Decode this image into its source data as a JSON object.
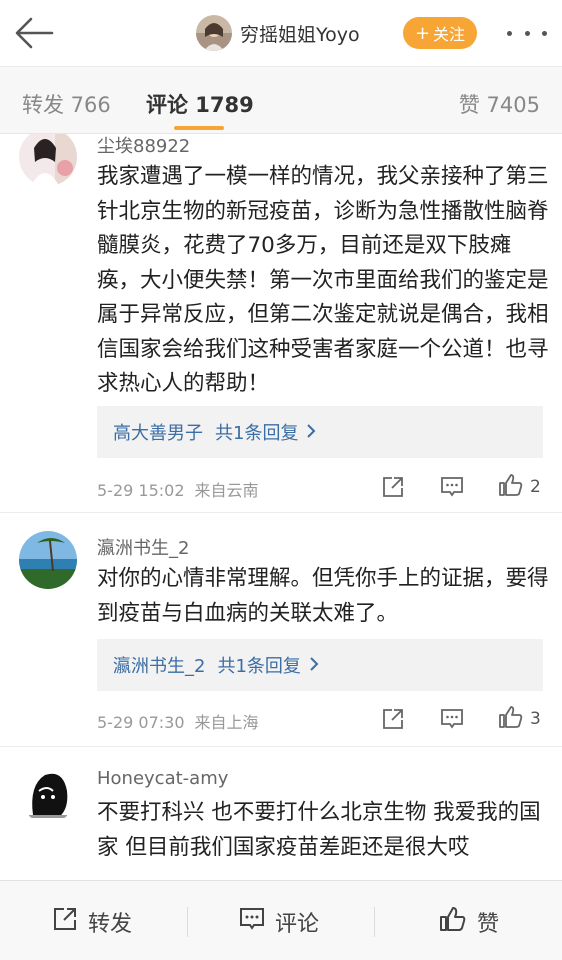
{
  "header": {
    "user_name": "穷摇姐姐Yoyo",
    "follow_label": "关注",
    "follow_plus": "+"
  },
  "tabs": {
    "repost": "转发 766",
    "comments": "评论 1789",
    "likes": "赞 7405"
  },
  "comments": [
    {
      "name": "尘埃88922",
      "text": "我家遭遇了一模一样的情况，我父亲接种了第三针北京生物的新冠疫苗，诊断为急性播散性脑脊髓膜炎，花费了70多万，目前还是双下肢瘫痪，大小便失禁！第一次市里面给我们的鉴定是属于异常反应，但第二次鉴定就说是偶合，我相信国家会给我们这种受害者家庭一个公道！也寻求热心人的帮助！",
      "reply_name": "高大善男子",
      "reply_count": "共1条回复",
      "time": "5-29 15:02",
      "location": "来自云南",
      "likes": "2"
    },
    {
      "name": "瀛洲书生_2",
      "text": "对你的心情非常理解。但凭你手上的证据，要得到疫苗与白血病的关联太难了。",
      "reply_name": "瀛洲书生_2",
      "reply_count": "共1条回复",
      "time": "5-29 07:30",
      "location": "来自上海",
      "likes": "3"
    },
    {
      "name": "Honeycat-amy",
      "text": "不要打科兴 也不要打什么北京生物 我爱我的国家 但目前我们国家疫苗差距还是很大哎"
    }
  ],
  "bottom_bar": {
    "repost": "转发",
    "comment": "评论",
    "like": "赞"
  },
  "colors": {
    "accent": "#f7a534",
    "link": "#3b6ea5"
  }
}
